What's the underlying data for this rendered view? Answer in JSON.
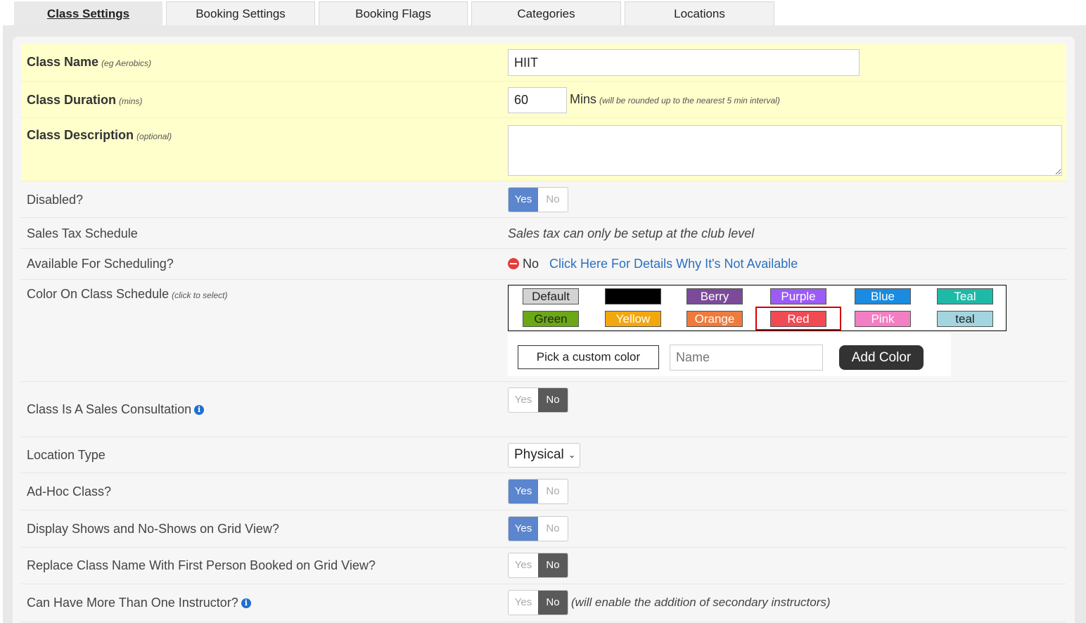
{
  "tabs": [
    "Class Settings",
    "Booking Settings",
    "Booking Flags",
    "Categories",
    "Locations"
  ],
  "class_name": {
    "label": "Class Name",
    "hint": "(eg Aerobics)",
    "value": "HIIT"
  },
  "class_duration": {
    "label": "Class Duration",
    "hint": "(mins)",
    "value": "60",
    "unit": "Mins",
    "note": "(will be rounded up to the nearest 5 min interval)"
  },
  "class_description": {
    "label": "Class Description",
    "hint": "(optional)",
    "value": ""
  },
  "disabled": {
    "label": "Disabled?",
    "yes": "Yes",
    "no": "No",
    "value": "Yes"
  },
  "sales_tax": {
    "label": "Sales Tax Schedule",
    "text": "Sales tax can only be setup at the club level"
  },
  "available": {
    "label": "Available For Scheduling?",
    "status": "No",
    "link": "Click Here For Details Why It's Not Available"
  },
  "color": {
    "label": "Color On Class Schedule",
    "hint": "(click to select)",
    "selected": "Red",
    "swatches": [
      {
        "name": "Default",
        "bg": "#d3d3d3",
        "fg": "#222"
      },
      {
        "name": "",
        "bg": "#000000",
        "fg": "#fff"
      },
      {
        "name": "Berry",
        "bg": "#7b4b99",
        "fg": "#fff"
      },
      {
        "name": "Purple",
        "bg": "#9b5cf5",
        "fg": "#fff"
      },
      {
        "name": "Blue",
        "bg": "#1a8be0",
        "fg": "#fff"
      },
      {
        "name": "Teal",
        "bg": "#1fb9a8",
        "fg": "#fff"
      },
      {
        "name": "Green",
        "bg": "#6aa814",
        "fg": "#222"
      },
      {
        "name": "Yellow",
        "bg": "#f3a70f",
        "fg": "#fff"
      },
      {
        "name": "Orange",
        "bg": "#ef7a3b",
        "fg": "#fff"
      },
      {
        "name": "Red",
        "bg": "#f14a53",
        "fg": "#fff"
      },
      {
        "name": "Pink",
        "bg": "#f37ec3",
        "fg": "#fff"
      },
      {
        "name": "teal",
        "bg": "#a3d5e0",
        "fg": "#222"
      }
    ],
    "custom_label": "Pick a custom color",
    "name_placeholder": "Name",
    "add_label": "Add Color"
  },
  "sales_consultation": {
    "label": "Class Is A Sales Consultation",
    "yes": "Yes",
    "no": "No",
    "value": "No"
  },
  "location_type": {
    "label": "Location Type",
    "value": "Physical"
  },
  "ad_hoc": {
    "label": "Ad-Hoc Class?",
    "yes": "Yes",
    "no": "No",
    "value": "Yes"
  },
  "shows": {
    "label": "Display Shows and No-Shows on Grid View?",
    "yes": "Yes",
    "no": "No",
    "value": "Yes"
  },
  "replace_name": {
    "label": "Replace Class Name With First Person Booked on Grid View?",
    "yes": "Yes",
    "no": "No",
    "value": "No"
  },
  "instructors": {
    "label": "Can Have More Than One Instructor?",
    "yes": "Yes",
    "no": "No",
    "value": "No",
    "note": "(will enable the addition of secondary instructors)"
  }
}
